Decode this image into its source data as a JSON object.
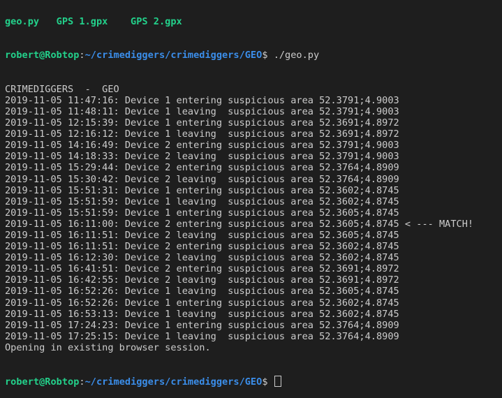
{
  "top_partial": "geo.py   GPS 1.gpx    GPS 2.gpx",
  "prompt": {
    "user_host": "robert@Robtop",
    "colon": ":",
    "path": "~/crimediggers/crimediggers/GEO",
    "symbol": "$ "
  },
  "command": "./geo.py",
  "output_lines": [
    "CRIMEDIGGERS  -  GEO",
    "2019-11-05 11:47:16: Device 1 entering suspicious area 52.3791;4.9003",
    "2019-11-05 11:48:11: Device 1 leaving  suspicious area 52.3791;4.9003",
    "2019-11-05 12:15:39: Device 1 entering suspicious area 52.3691;4.8972",
    "2019-11-05 12:16:12: Device 1 leaving  suspicious area 52.3691;4.8972",
    "2019-11-05 14:16:49: Device 2 entering suspicious area 52.3791;4.9003",
    "2019-11-05 14:18:33: Device 2 leaving  suspicious area 52.3791;4.9003",
    "2019-11-05 15:29:44: Device 2 entering suspicious area 52.3764;4.8909",
    "2019-11-05 15:30:42: Device 2 leaving  suspicious area 52.3764;4.8909",
    "2019-11-05 15:51:31: Device 1 entering suspicious area 52.3602;4.8745",
    "2019-11-05 15:51:59: Device 1 leaving  suspicious area 52.3602;4.8745",
    "2019-11-05 15:51:59: Device 1 entering suspicious area 52.3605;4.8745",
    "2019-11-05 16:11:00: Device 2 entering suspicious area 52.3605;4.8745 < --- MATCH!",
    "2019-11-05 16:11:51: Device 2 leaving  suspicious area 52.3605;4.8745",
    "2019-11-05 16:11:51: Device 2 entering suspicious area 52.3602;4.8745",
    "2019-11-05 16:12:30: Device 2 leaving  suspicious area 52.3602;4.8745",
    "2019-11-05 16:41:51: Device 2 entering suspicious area 52.3691;4.8972",
    "2019-11-05 16:42:55: Device 2 leaving  suspicious area 52.3691;4.8972",
    "2019-11-05 16:52:26: Device 1 leaving  suspicious area 52.3605;4.8745",
    "2019-11-05 16:52:26: Device 1 entering suspicious area 52.3602;4.8745",
    "2019-11-05 16:53:13: Device 1 leaving  suspicious area 52.3602;4.8745",
    "2019-11-05 17:24:23: Device 1 entering suspicious area 52.3764;4.8909",
    "2019-11-05 17:25:15: Device 1 leaving  suspicious area 52.3764;4.8909",
    "Opening in existing browser session."
  ],
  "colors": {
    "background": "#1e1e1e",
    "text": "#cccccc",
    "prompt_user": "#23d18b",
    "prompt_path": "#3b8eea"
  }
}
